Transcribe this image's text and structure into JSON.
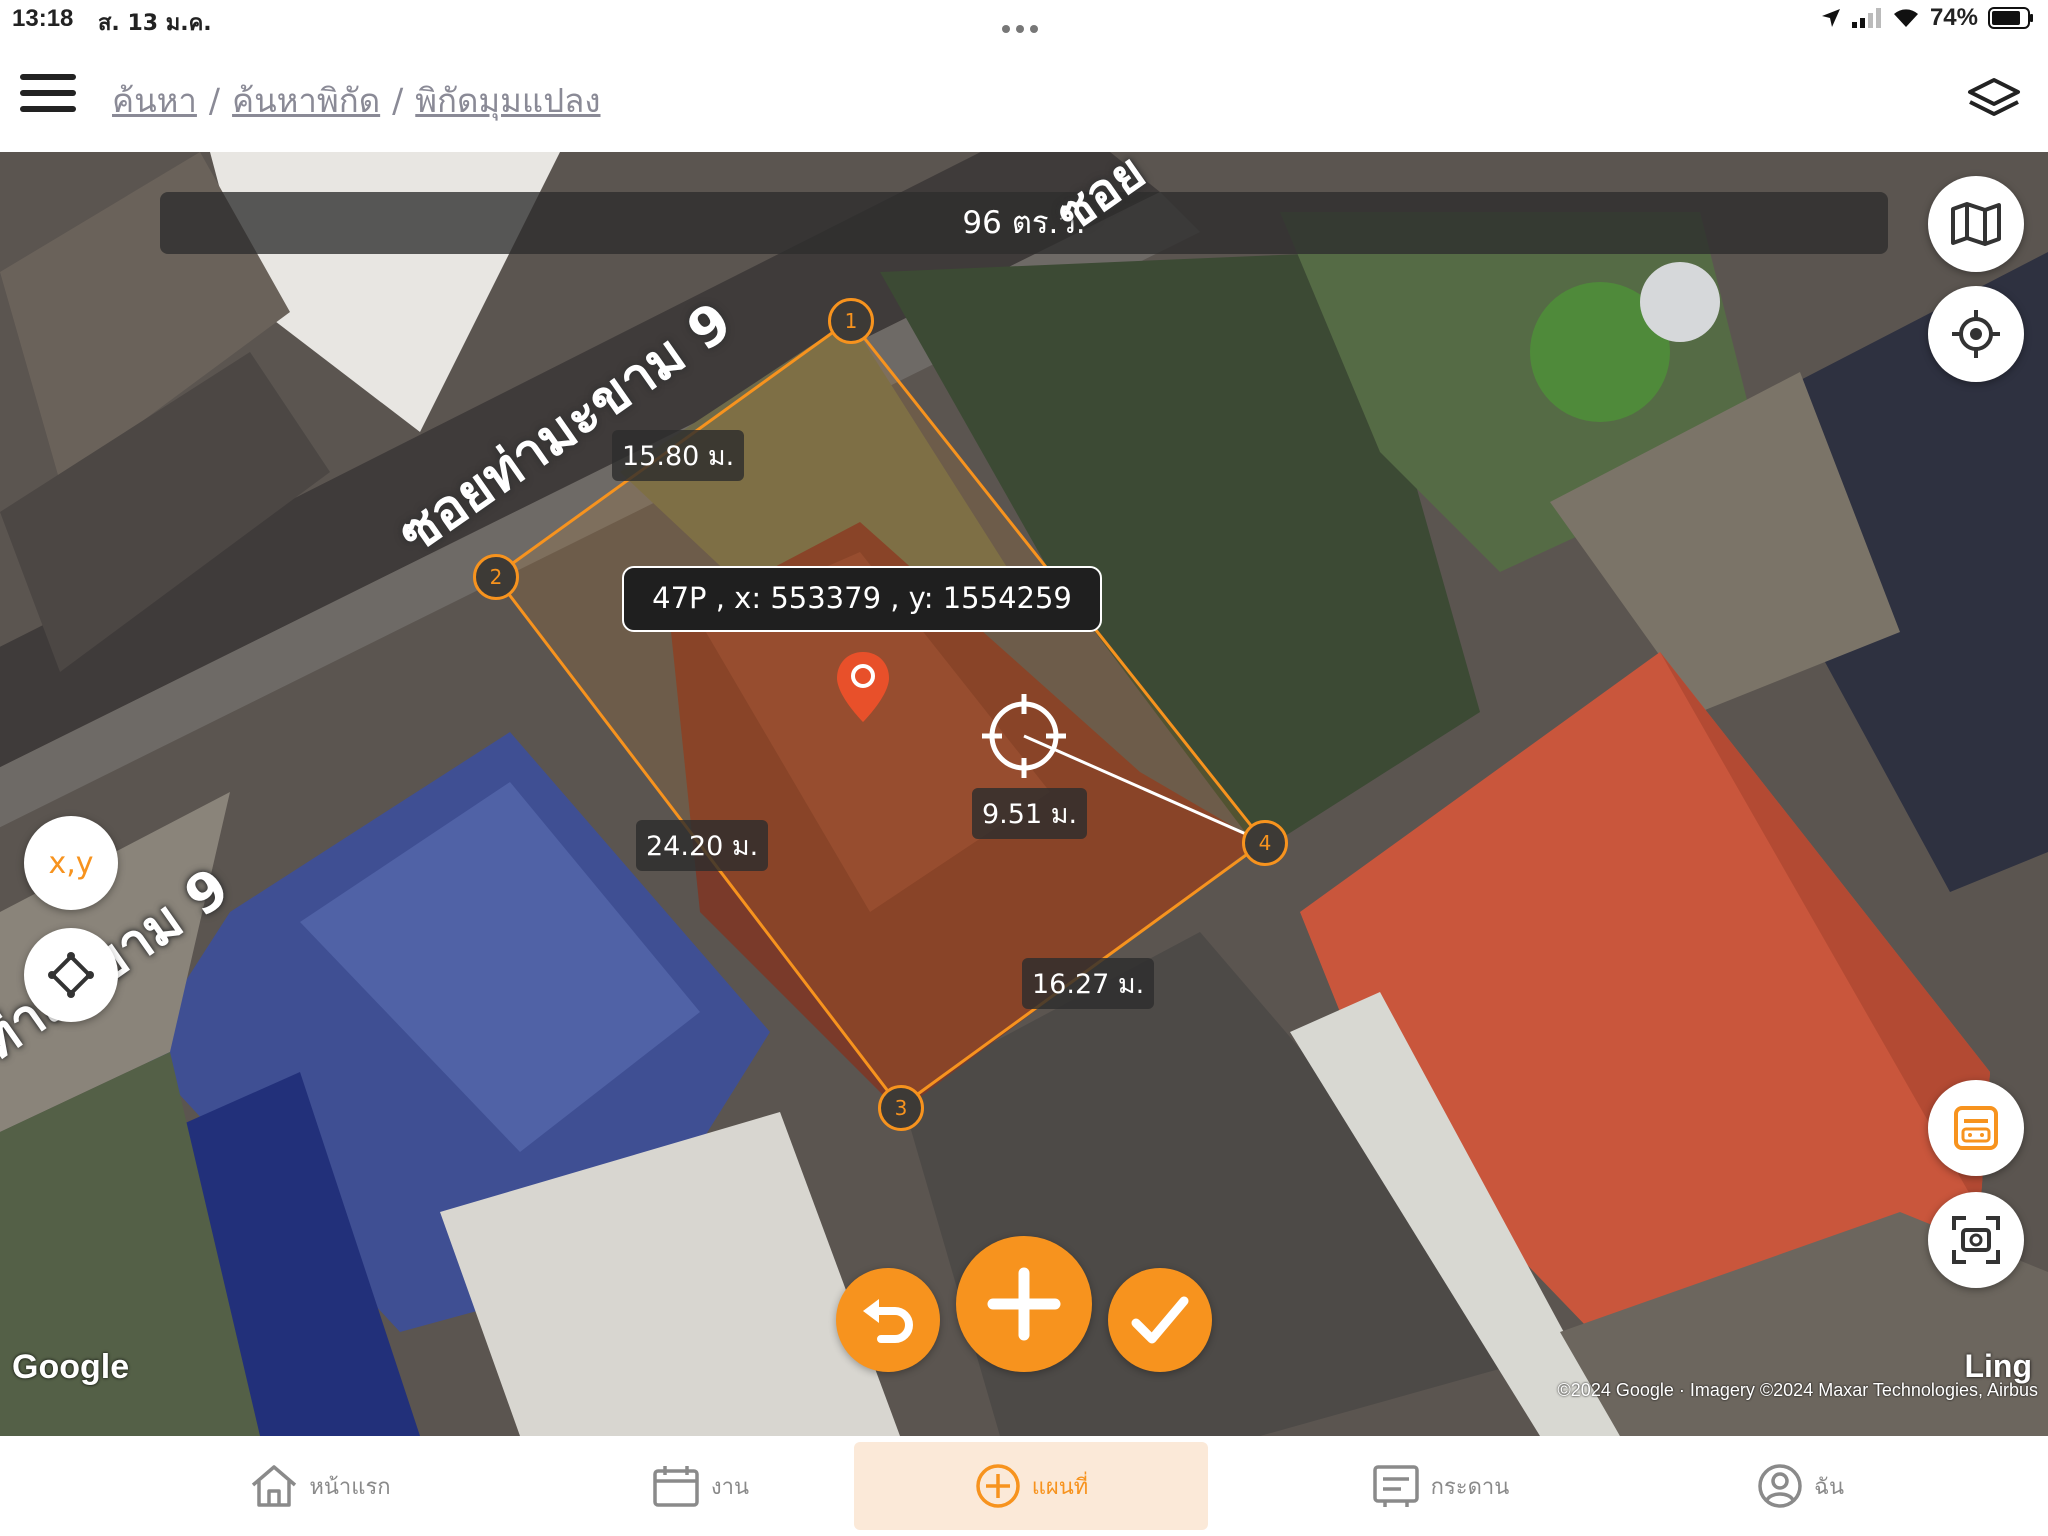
{
  "status": {
    "time": "13:18",
    "date": "ส. 13 ม.ค.",
    "battery": "74%"
  },
  "header": {
    "breadcrumbs": [
      "ค้นหา",
      "ค้นหาพิกัด",
      "พิกัดมุมแปลง"
    ],
    "separator": "/"
  },
  "map": {
    "area_label": "96 ตร.ว.",
    "road_label": "ซอยท่ามะขาม 9",
    "road_label_2": "ท่ามะขาม 9",
    "road_label_3": "ซอย",
    "vertices": [
      "1",
      "2",
      "3",
      "4"
    ],
    "distances": {
      "d12": "15.80 ม.",
      "d23": "24.20 ม.",
      "d34": "16.27 ม.",
      "d_cursor": "9.51 ม."
    },
    "coordinate_readout": "47P , x: 553379 , y: 1554259",
    "google_logo": "Google",
    "copyright": "©2024 Google · Imagery ©2024 Maxar Technologies, Airbus",
    "attribution_suffix": "Ling"
  },
  "controls": {
    "xy_label": "x,y",
    "icons": {
      "map": "map-icon",
      "locate": "locate-icon",
      "xy": "xy-icon",
      "diamond": "diamond-icon",
      "calculator": "calculator-icon",
      "screenshot": "screenshot-icon",
      "undo": "undo-icon",
      "add": "plus-icon",
      "confirm": "check-icon"
    },
    "accent_color": "#f7931e"
  },
  "tabs": [
    {
      "label": "หน้าแรก",
      "icon": "home-icon"
    },
    {
      "label": "งาน",
      "icon": "calendar-icon"
    },
    {
      "label": "แผนที่",
      "icon": "plus-circle-icon",
      "active": true
    },
    {
      "label": "กระดาน",
      "icon": "board-icon"
    },
    {
      "label": "ฉัน",
      "icon": "user-icon"
    }
  ]
}
